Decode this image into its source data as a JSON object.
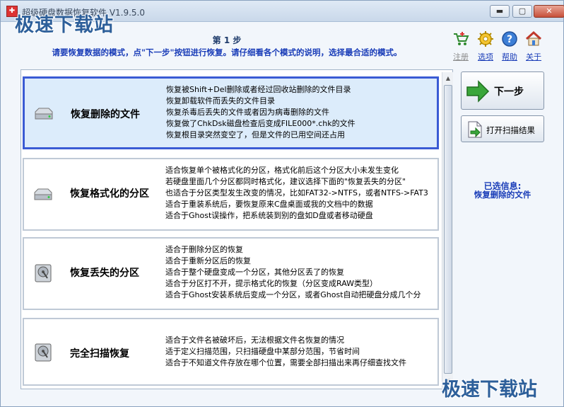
{
  "window": {
    "title": "超级硬盘数据恢复软件 V1.9.5.0",
    "watermark": "极速下载站",
    "minimize_glyph": "▬",
    "maximize_glyph": "▢",
    "close_glyph": "✕"
  },
  "step": {
    "title": "第 1 步",
    "description": "请要恢复数据的模式，点\"下一步\"按钮进行恢复。请仔细看各个模式的说明，选择最合适的模式。"
  },
  "toolbar": {
    "register": "注册",
    "options": "选项",
    "help": "帮助",
    "about": "关于"
  },
  "modes": [
    {
      "name": "恢复删除的文件",
      "icon": "drive-icon",
      "selected": true,
      "lines": [
        "恢复被Shift+Del删除或者经过回收站删除的文件目录",
        "恢复卸载软件而丢失的文件目录",
        "恢复杀毒后丢失的文件或者因为病毒删除的文件",
        "恢复做了ChkDsk磁盘检查后变成FILE000*.chk的文件",
        "恢复根目录突然变空了，但是文件的已用空间还占用"
      ]
    },
    {
      "name": "恢复格式化的分区",
      "icon": "drive-icon",
      "selected": false,
      "lines": [
        "适合恢复单个被格式化的分区，格式化前后这个分区大小未发生变化",
        "若硬盘里面几个分区都同时格式化，建议选择下面的\"恢复丢失的分区\"",
        "也适合于分区类型发生改变的情况，比如FAT32->NTFS，或者NTFS->FAT3",
        "适合于重装系统后，要恢复原来C盘桌面或我的文档中的数据",
        "适合于Ghost误操作，把系统装到别的盘如D盘或者移动硬盘"
      ]
    },
    {
      "name": "恢复丢失的分区",
      "icon": "hard-disk-icon",
      "selected": false,
      "lines": [
        "适合于删除分区的恢复",
        "适合于重新分区后的恢复",
        "适合于整个硬盘变成一个分区，其他分区丢了的恢复",
        "适合于分区打不开，提示格式化的恢复（分区变成RAW类型）",
        "适合于Ghost安装系统后变成一个分区，或者Ghost自动把硬盘分成几个分"
      ]
    },
    {
      "name": "完全扫描恢复",
      "icon": "hard-disk-icon",
      "selected": false,
      "lines": [
        "适合于文件名被破坏后，无法根据文件名恢复的情况",
        "适于定义扫描范围，只扫描硬盘中某部分范围，节省时间",
        "适合于不知道文件存放在哪个位置，需要全部扫描出来再仔细查找文件"
      ]
    }
  ],
  "actions": {
    "next": "下一步",
    "open_scan": "打开扫描结果"
  },
  "info": {
    "label": "已选信息:",
    "value": "恢复删除的文件"
  },
  "colors": {
    "accent_blue": "#1a3db8",
    "selected_border": "#3a5bd4",
    "selected_bg": "#dcecfb",
    "next_arrow": "#2e9a2e"
  }
}
